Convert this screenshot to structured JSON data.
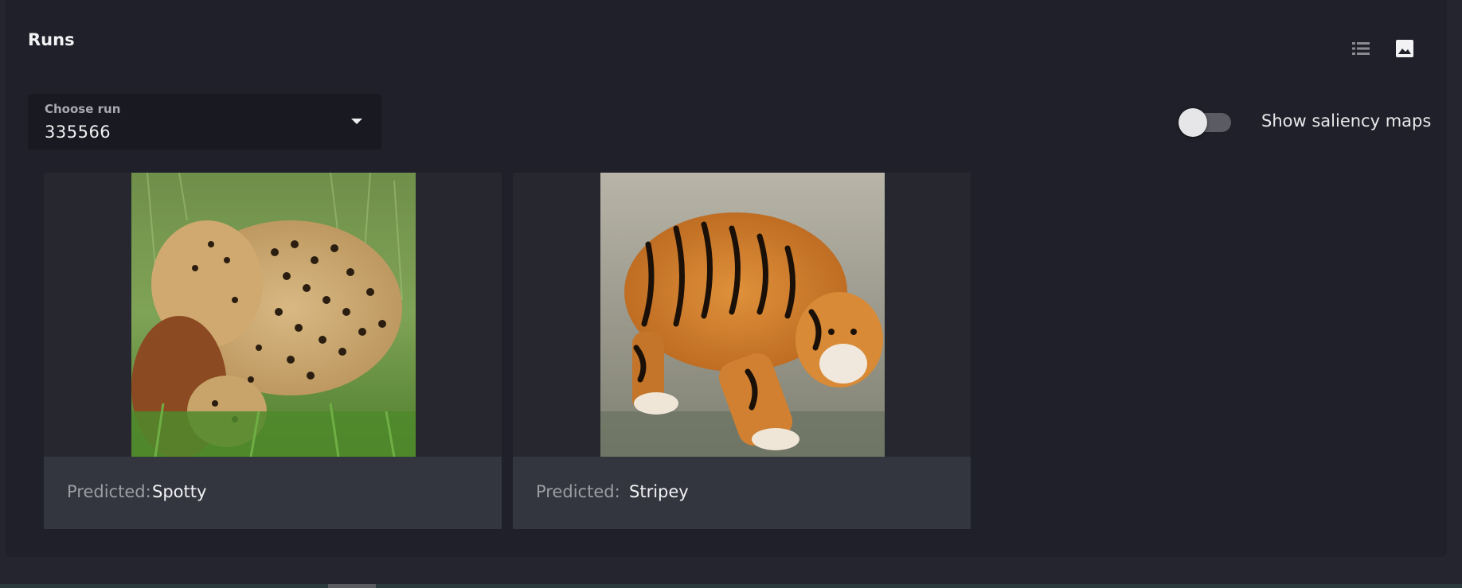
{
  "panel": {
    "title": "Runs"
  },
  "view_toggle": {
    "list_icon": "list-icon",
    "image_icon": "image-icon",
    "active": "image"
  },
  "run_select": {
    "label": "Choose run",
    "value": "335566"
  },
  "saliency_toggle": {
    "label": "Show saliency maps",
    "checked": false
  },
  "cards": [
    {
      "image": "cheetah",
      "predicted_label": "Predicted:",
      "predicted_value": "Spotty"
    },
    {
      "image": "tiger",
      "predicted_label": "Predicted:",
      "predicted_value": "Stripey"
    }
  ],
  "colors": {
    "background": "#1f2029",
    "card_footer": "#34363f",
    "select_bg": "#191a21"
  }
}
